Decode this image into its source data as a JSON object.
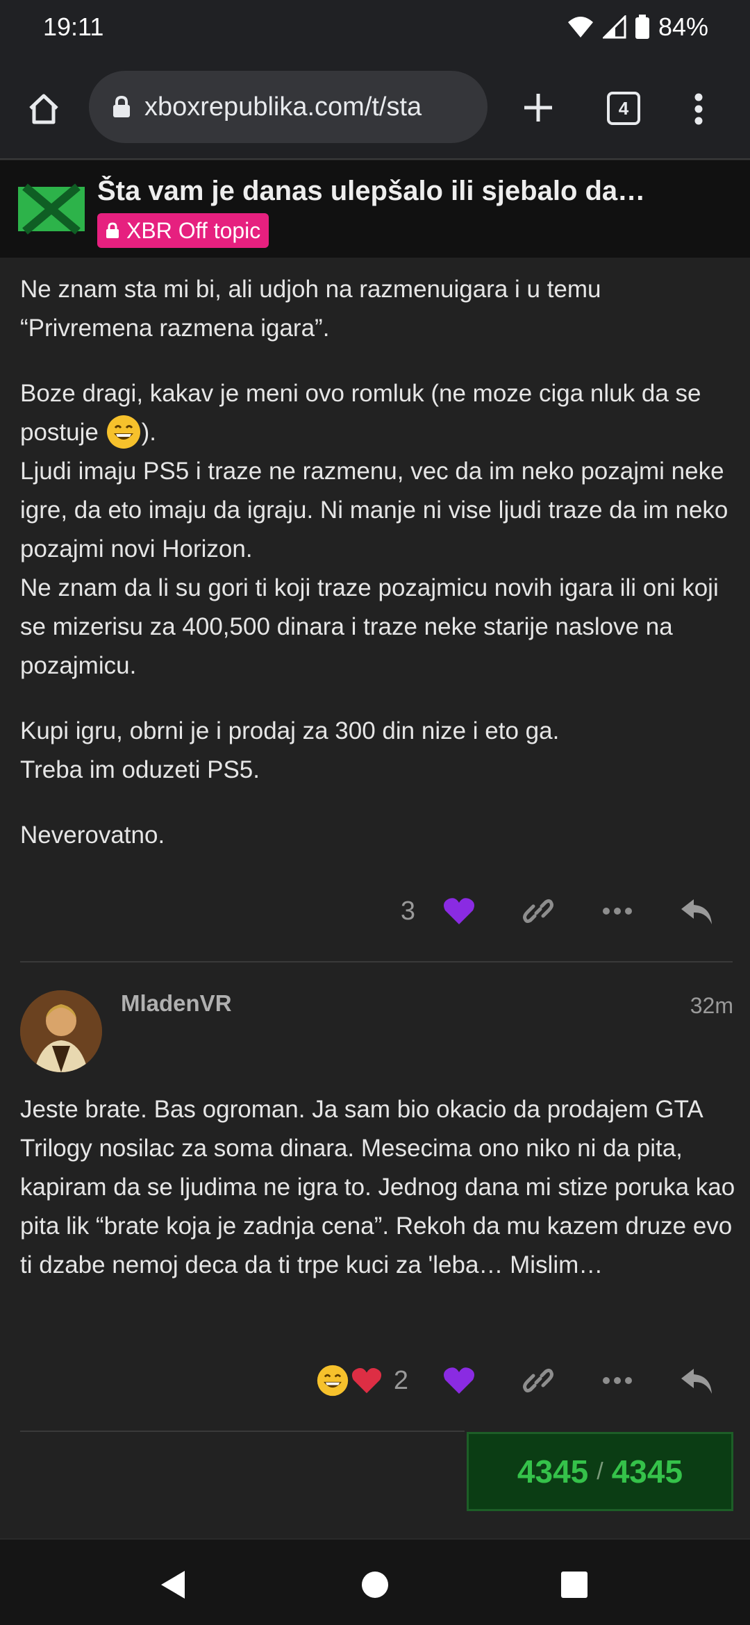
{
  "status_bar": {
    "time": "19:11",
    "battery": "84%"
  },
  "browser": {
    "url": "xboxrepublika.com/t/sta",
    "tab_count": "4"
  },
  "topic": {
    "title": "Šta vam je danas ulepšalo ili sjebalo da…",
    "category": "XBR Off topic"
  },
  "post1": {
    "p1": "Ne znam sta mi bi, ali udjoh na razmenuigara i u temu “Privremena razmena igara”.",
    "p2a": "Boze dragi, kakav je meni ovo romluk (ne moze ciga nluk da se postuje ",
    "p2b": ").",
    "p2c": "Ljudi imaju PS5 i traze ne razmenu, vec da im neko pozajmi neke igre, da eto imaju da igraju. Ni manje ni vise ljudi traze da im neko pozajmi novi Horizon.",
    "p2d": "Ne znam da li su gori ti koji traze pozajmicu novih igara ili oni koji se mizerisu za 400,500 dinara i traze neke starije naslove na pozajmicu.",
    "p3a": "Kupi igru, obrni je i prodaj za 300 din nize i eto ga.",
    "p3b": "Treba im oduzeti PS5.",
    "p4": "Neverovatno.",
    "like_count": "3"
  },
  "post2": {
    "username": "MladenVR",
    "age": "32m",
    "body": "Jeste brate. Bas ogroman. Ja sam bio okacio da prodajem GTA Trilogy nosilac za soma dinara. Mesecima ono niko ni da pita, kapiram da se ljudima ne igra to. Jednog dana mi stize poruka kao pita lik “brate koja je zadnja cena”. Rekoh da mu kazem druze evo ti dzabe nemoj deca da ti trpe kuci za 'leba… Mislim…",
    "reaction_count": "2"
  },
  "progress": {
    "current": "4345",
    "total": "4345"
  },
  "colors": {
    "like": "#8a2be2",
    "badge": "#e6207f",
    "progress_text": "#35c24a"
  }
}
